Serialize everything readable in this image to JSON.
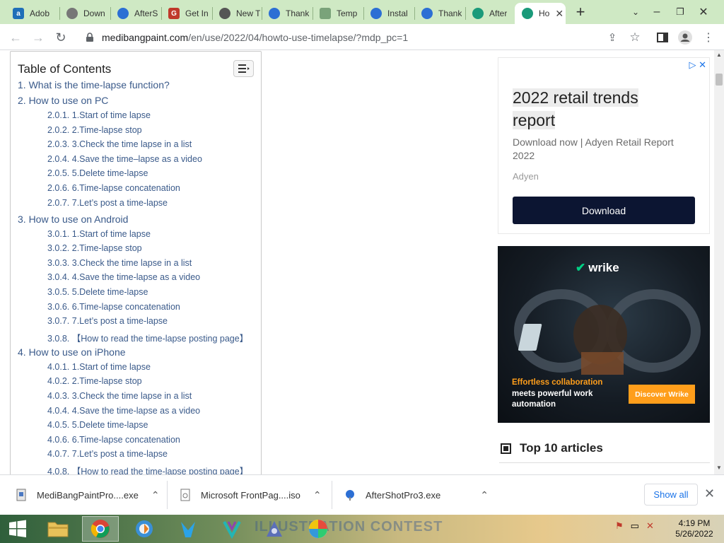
{
  "tabs": [
    {
      "label": "Adob",
      "icon": "adobe-icon",
      "color": "#1f6fb8"
    },
    {
      "label": "Down",
      "icon": "globe-icon",
      "color": "#666666"
    },
    {
      "label": "AfterS",
      "icon": "aftershot-icon",
      "color": "#2c6fd4"
    },
    {
      "label": "Get In",
      "icon": "g-icon",
      "color": "#c0392b"
    },
    {
      "label": "New T",
      "icon": "chrome-icon",
      "color": "#555555"
    },
    {
      "label": "Thank",
      "icon": "aftershot-icon",
      "color": "#2c6fd4"
    },
    {
      "label": "Temp",
      "icon": "template-icon",
      "color": "#7aa37a"
    },
    {
      "label": "Instal",
      "icon": "aftershot-icon",
      "color": "#2c6fd4"
    },
    {
      "label": "Thank",
      "icon": "aftershot-icon",
      "color": "#2c6fd4"
    },
    {
      "label": "After",
      "icon": "medibang-icon",
      "color": "#1a9a7a"
    },
    {
      "label": "Ho",
      "icon": "medibang-icon",
      "color": "#1a9a7a"
    }
  ],
  "url": {
    "host": "medibangpaint.com",
    "path": "/en/use/2022/04/howto-use-timelapse/?mdp_pc=1"
  },
  "toc": {
    "title": "Table of Contents",
    "items": [
      {
        "level": 1,
        "text": "1. What is the time-lapse function?"
      },
      {
        "level": 1,
        "text": "2. How to use on PC"
      },
      {
        "level": 2,
        "text": "2.0.1. 1.Start of time lapse"
      },
      {
        "level": 2,
        "text": "2.0.2. 2.Time-lapse stop"
      },
      {
        "level": 2,
        "text": "2.0.3. 3.Check the time lapse in a list"
      },
      {
        "level": 2,
        "text": "2.0.4. 4.Save the time–lapse as a video"
      },
      {
        "level": 2,
        "text": "2.0.5. 5.Delete time-lapse"
      },
      {
        "level": 2,
        "text": "2.0.6. 6.Time-lapse concatenation"
      },
      {
        "level": 2,
        "text": "2.0.7. 7.Let’s post a time-lapse"
      },
      {
        "level": 1,
        "text": "3. How to use on Android"
      },
      {
        "level": 2,
        "text": "3.0.1. 1.Start of time lapse"
      },
      {
        "level": 2,
        "text": "3.0.2. 2.Time-lapse stop"
      },
      {
        "level": 2,
        "text": "3.0.3. 3.Check the time lapse in a list"
      },
      {
        "level": 2,
        "text": "3.0.4. 4.Save the time-lapse as a video"
      },
      {
        "level": 2,
        "text": "3.0.5. 5.Delete time-lapse"
      },
      {
        "level": 2,
        "text": "3.0.6. 6.Time-lapse concatenation"
      },
      {
        "level": 2,
        "text": "3.0.7. 7.Let’s post a time-lapse"
      },
      {
        "level": 2,
        "text": "3.0.8. 【How to read the time-lapse posting page】"
      },
      {
        "level": 1,
        "text": "4. How to use on iPhone"
      },
      {
        "level": 2,
        "text": "4.0.1. 1.Start of time lapse"
      },
      {
        "level": 2,
        "text": "4.0.2. 2.Time-lapse stop"
      },
      {
        "level": 2,
        "text": "4.0.3. 3.Check the time lapse in a list"
      },
      {
        "level": 2,
        "text": "4.0.4. 4.Save the time-lapse as a video"
      },
      {
        "level": 2,
        "text": "4.0.5. 5.Delete time-lapse"
      },
      {
        "level": 2,
        "text": "4.0.6. 6.Time-lapse concatenation"
      },
      {
        "level": 2,
        "text": "4.0.7. 7.Let’s post a time-lapse"
      },
      {
        "level": 2,
        "text": "4.0.8. 【How to read the time-lapse posting page】"
      }
    ]
  },
  "ad": {
    "headline_line1": "2022 retail trends",
    "headline_line2": "report",
    "description": "Download now | Adyen Retail Report 2022",
    "advertiser": "Adyen",
    "cta": "Download"
  },
  "wrike": {
    "logo": "wrike",
    "tagline_orange": "Effortless collaboration",
    "tagline_white": "meets powerful work automation",
    "cta": "Discover Wrike"
  },
  "sidebar_heading": "Top 10 articles",
  "downloads": [
    {
      "name": "MediBangPaintPro....exe"
    },
    {
      "name": "Microsoft FrontPag....iso"
    },
    {
      "name": "AfterShotPro3.exe"
    }
  ],
  "show_all": "Show all",
  "clock": {
    "time": "4:19 PM",
    "date": "5/26/2022"
  },
  "wallpaper_text": "ILLUSTRATION CONTEST"
}
